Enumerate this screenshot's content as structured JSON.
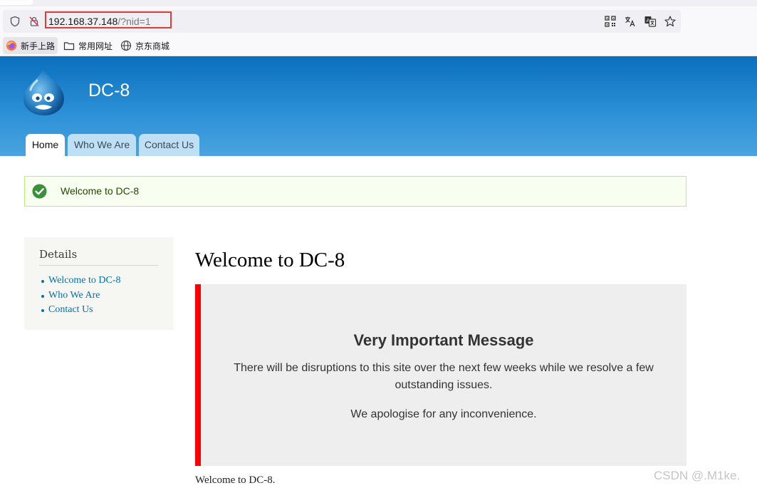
{
  "browser": {
    "url_host": "192.168.37.148",
    "url_path": "/?nid=1",
    "bookmarks": [
      "新手上路",
      "常用网址",
      "京东商城"
    ]
  },
  "site": {
    "name": "DC-8",
    "tabs": [
      "Home",
      "Who We Are",
      "Contact Us"
    ],
    "active_tab": "Home"
  },
  "status_message": "Welcome to DC-8",
  "sidebar": {
    "title": "Details",
    "links": [
      "Welcome to DC-8",
      "Who We Are",
      "Contact Us"
    ]
  },
  "main": {
    "title": "Welcome to DC-8",
    "message_heading": "Very Important Message",
    "message_body": "There will be disruptions to this site over the next few weeks while we resolve a few outstanding issues.",
    "message_apology": "We apologise for any inconvenience.",
    "body_text": "Welcome to DC-8."
  },
  "watermark": "CSDN @.M1ke.",
  "colors": {
    "header_top": "#0a6fbd",
    "header_bottom": "#4aa3df",
    "link": "#0071b3",
    "message_border": "#ff0000",
    "status_bg": "#f8fff0",
    "url_highlight": "#e53935"
  }
}
